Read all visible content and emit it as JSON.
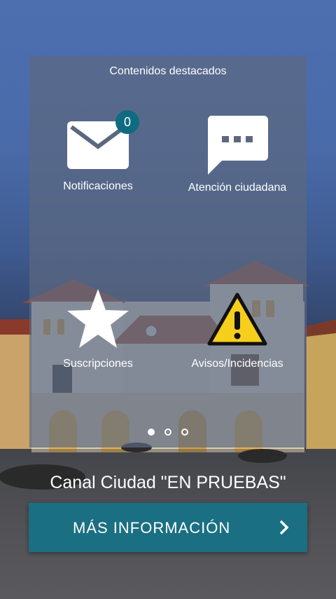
{
  "panel": {
    "title": "Contenidos destacados",
    "tiles": [
      {
        "label": "Notificaciones",
        "icon": "mail-icon",
        "badge": "0"
      },
      {
        "label": "Atención ciudadana",
        "icon": "chat-bubble-icon"
      },
      {
        "label": "Suscripciones",
        "icon": "star-icon"
      },
      {
        "label": "Avisos/Incidencias",
        "icon": "warning-icon"
      }
    ],
    "pager": {
      "pages": 3,
      "active": 1
    }
  },
  "channel": {
    "title": "Canal Ciudad \"EN PRUEBAS\""
  },
  "button": {
    "label": "MÁS INFORMACIÓN",
    "icon": "chevron-right-icon"
  },
  "colors": {
    "accent": "#1b6f83",
    "badge": "#0f6b80",
    "warning": "#f6cf1c"
  }
}
